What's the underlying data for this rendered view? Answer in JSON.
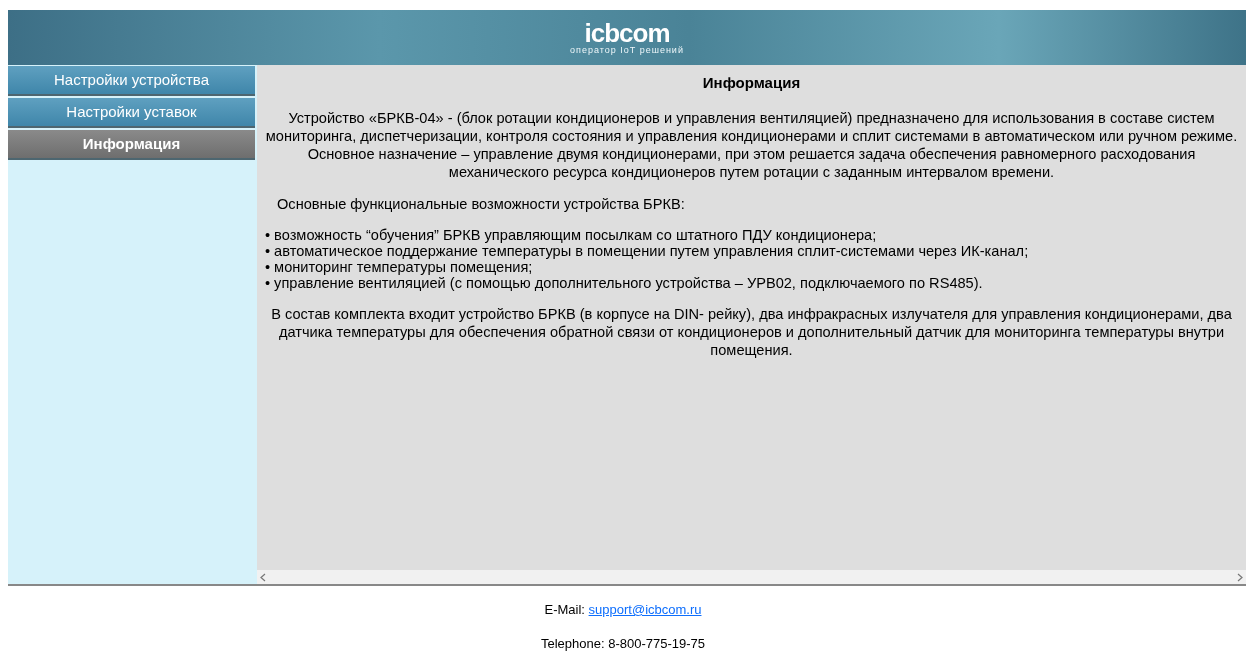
{
  "header": {
    "logo": "icbcom",
    "tagline": "оператор IoT решений"
  },
  "sidebar": {
    "items": [
      {
        "label": "Настройки устройства",
        "selected": false
      },
      {
        "label": "Настройки уставок",
        "selected": false
      },
      {
        "label": "Информация",
        "selected": true
      }
    ]
  },
  "content": {
    "title": "Информация",
    "intro": "Устройство «БРКВ-04» - (блок ротации кондиционеров и управления вентиляцией) предназначено для использования в составе систем мониторинга, диспетчеризации, контроля состояния и управления кондиционерами и сплит системами в автоматическом или ручном режиме. Основное назначение – управление двумя кондиционерами, при этом решается задача обеспечения равномерного расходования механического ресурса кондиционеров путем ротации с заданным интервалом времени.",
    "features_heading": "Основные функциональные возможности устройства БРКВ:",
    "features": [
      {
        "bullet": "•",
        "text": "возможность “обучения” БРКВ управляющим посылкам со штатного ПДУ кондиционера;"
      },
      {
        "bullet": "•",
        "text": "автоматическое поддержание температуры в помещении путем управления сплит-системами через ИК-канал;"
      },
      {
        "bullet": "•",
        "text": "мониторинг температуры помещения;"
      },
      {
        "bullet": "•",
        "text": "управление вентиляцией (с помощью дополнительного устройства – УРВ02, подключаемого по RS485)."
      }
    ],
    "kit": "В состав комплекта входит устройство БРКВ (в корпусе на DIN- рейку), два инфракрасных излучателя для управления кондиционерами, два датчика температуры для обеспечения обратной связи от кондиционеров и дополнительный датчик для мониторинга температуры внутри помещения."
  },
  "footer": {
    "email_label": "E-Mail:",
    "email": "support@icbcom.ru",
    "phone": "Telephone: 8-800-775-19-75"
  }
}
